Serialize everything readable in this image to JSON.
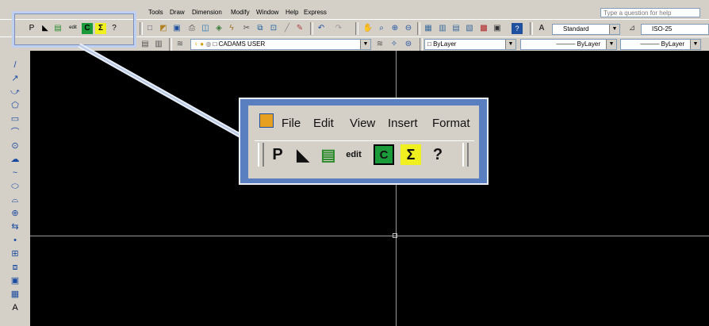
{
  "menubar": {
    "items": [
      "File",
      "Edit",
      "View",
      "Insert",
      "Format",
      "Tools",
      "Draw",
      "Dimension",
      "Modify",
      "Window",
      "Help",
      "Express"
    ],
    "help_placeholder": "Type a question for help"
  },
  "toolbar1": {
    "left_buttons": [
      "P",
      "◣",
      "▤",
      "edit",
      "C",
      "Σ",
      "?"
    ],
    "text_style": "Standard",
    "dim_style": "ISO-25"
  },
  "toolbar2": {
    "layer_name": "CADAMS USER",
    "color": "ByLayer",
    "linetype": "ByLayer",
    "lineweight": "ByLayer"
  },
  "left_toolbar": {
    "tools": [
      "/",
      "↗",
      "⤻",
      "⬠",
      "▭",
      "⌒",
      "⊙",
      "☁",
      "~",
      "⬭",
      "⌓",
      "⊕",
      "⇆",
      "•",
      "⊞",
      "⧈",
      "▣",
      "▦",
      "A"
    ]
  },
  "zoom": {
    "menu": [
      "File",
      "Edit",
      "View",
      "Insert",
      "Format"
    ],
    "buttons": [
      "P",
      "◣",
      "▤",
      "edit",
      "C",
      "Σ",
      "?"
    ]
  },
  "colors": {
    "canvas": "#000000",
    "callout_bg": "#5a7fc0",
    "toolbar_bg": "#d4d0c8"
  }
}
